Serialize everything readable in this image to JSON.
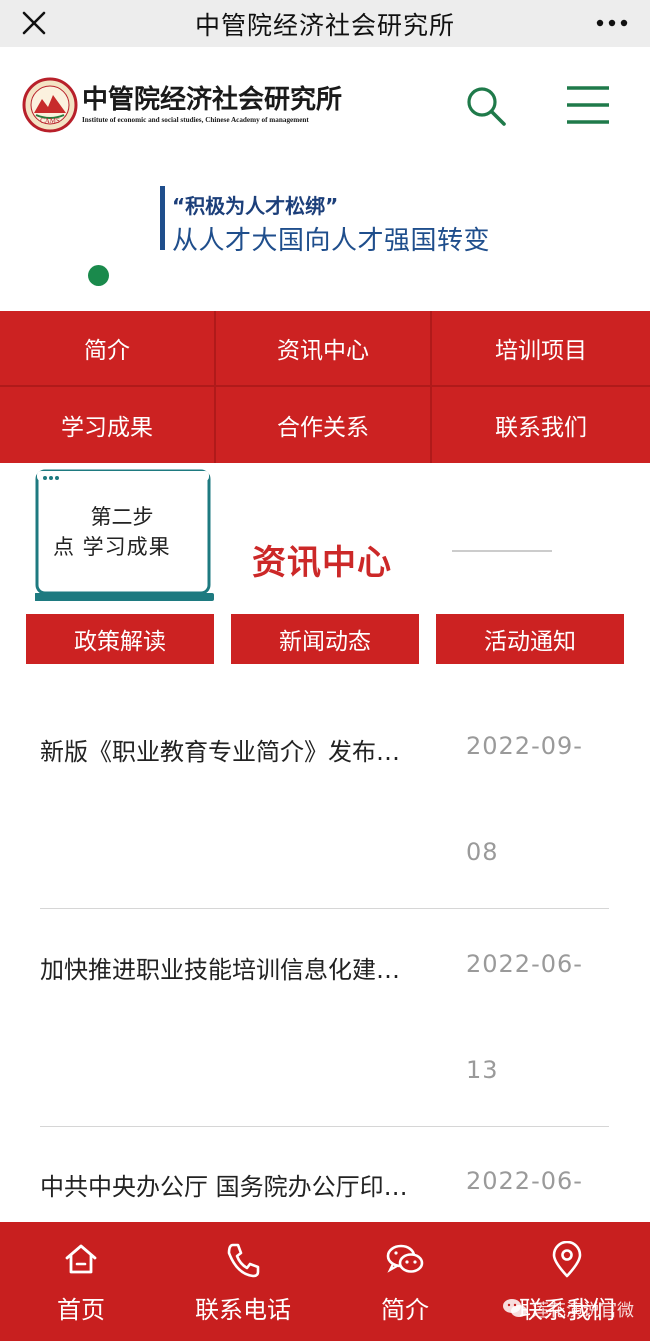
{
  "topbar": {
    "title": "中管院经济社会研究所"
  },
  "header": {
    "logo_cn": "中管院经济社会研究所",
    "logo_en": "Institute of economic and social studies, Chinese Academy of management",
    "logo_seal_text": "CAMS"
  },
  "banner": {
    "line1": "“积极为人才松绑”",
    "line2": "从人才大国向人才强国转变"
  },
  "nav": [
    {
      "label": "简介"
    },
    {
      "label": "资讯中心"
    },
    {
      "label": "培训项目"
    },
    {
      "label": "学习成果"
    },
    {
      "label": "合作关系"
    },
    {
      "label": "联系我们"
    }
  ],
  "section": {
    "note_line1": "第二步",
    "note_line2": "点 学习成果",
    "title": "资讯中心"
  },
  "tabs": [
    {
      "label": "政策解读"
    },
    {
      "label": "新闻动态"
    },
    {
      "label": "活动通知"
    }
  ],
  "news": [
    {
      "title": "新版《职业教育专业简介》发布…",
      "date_line1": "2022-09-",
      "date_line2": "08"
    },
    {
      "title": "加快推进职业技能培训信息化建…",
      "date_line1": "2022-06-",
      "date_line2": "13"
    },
    {
      "title": "中共中央办公厅 国务院办公厅印…",
      "date_line1": "2022-06-",
      "date_line2": ""
    }
  ],
  "bottom_nav": [
    {
      "label": "首页",
      "icon": "home-icon"
    },
    {
      "label": "联系电话",
      "icon": "phone-icon"
    },
    {
      "label": "简介",
      "icon": "chat-icon"
    },
    {
      "label": "联系我们",
      "icon": "location-icon"
    }
  ],
  "watermark": "莲花演说官微",
  "colors": {
    "brand_red": "#cc2222",
    "title_red": "#cc2828",
    "accent_green": "#1a8a4c",
    "banner_blue": "#1f4e8c",
    "date_gray": "#9a9a9a"
  }
}
